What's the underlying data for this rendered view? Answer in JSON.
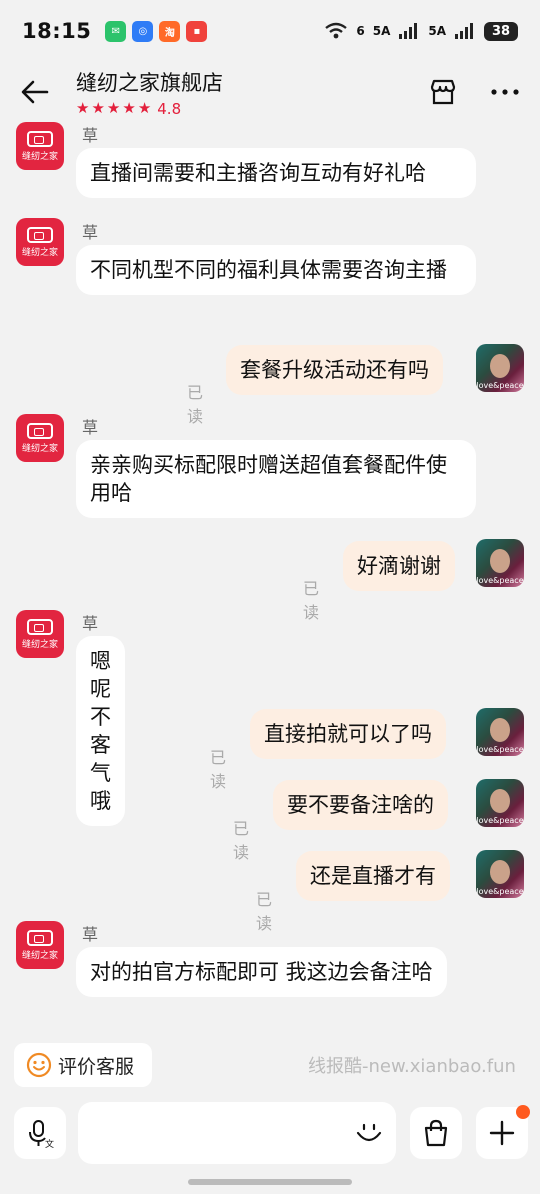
{
  "status_bar": {
    "time": "18:15",
    "app_icons": [
      {
        "name": "wechat-icon",
        "color": "#2cc36b",
        "glyph": "✉"
      },
      {
        "name": "browser-icon",
        "color": "#2f7cf6",
        "glyph": "◎"
      },
      {
        "name": "taobao-icon",
        "color": "#ff6a28",
        "glyph": "淘"
      },
      {
        "name": "app-icon",
        "color": "#f0423c",
        "glyph": "▪"
      }
    ],
    "signal_1": "6",
    "signal_2": "5A",
    "signal_3": "5A",
    "battery": "38"
  },
  "header": {
    "shop_name": "缝纫之家旗舰店",
    "rating": "4.8",
    "stars": 5,
    "accent": "#e3203c"
  },
  "conversation": {
    "shop_sender": "草莓",
    "shop_avatar_text": "缝纫之家",
    "user_avatar_text": "love&peace",
    "read_label": "已读",
    "messages": [
      {
        "side": "left",
        "text": "直播间需要和主播咨询互动有好礼哈"
      },
      {
        "side": "left",
        "text": "不同机型不同的福利具体需要咨询主播"
      },
      {
        "side": "right",
        "text": "套餐升级活动还有吗"
      },
      {
        "side": "left",
        "text": "亲亲购买标配限时赠送超值套餐配件使用哈"
      },
      {
        "side": "right",
        "text": "好滴谢谢"
      },
      {
        "side": "left",
        "text": "嗯呢不客气哦"
      },
      {
        "side": "right",
        "text": "直接拍就可以了吗"
      },
      {
        "side": "right",
        "text": "要不要备注啥的"
      },
      {
        "side": "right",
        "text": "还是直播才有"
      },
      {
        "side": "left",
        "text": "对的拍官方标配即可 我这边会备注哈"
      }
    ]
  },
  "bottom": {
    "review_label": "评价客服",
    "watermark": "线报酷-new.xianbao.fun",
    "input_value": "",
    "colors": {
      "bubble_right": "#fdeee2",
      "badge": "#ff5a1f"
    }
  }
}
